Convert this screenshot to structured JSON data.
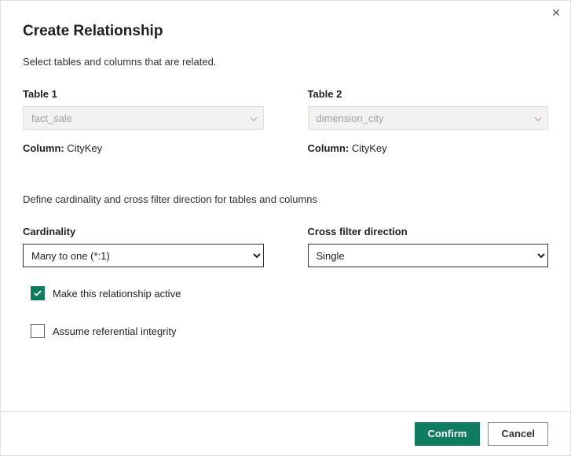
{
  "dialog": {
    "title": "Create Relationship",
    "subtitle": "Select tables and columns that are related."
  },
  "table1": {
    "label": "Table 1",
    "value": "fact_sale",
    "column_label": "Column:",
    "column_value": "CityKey"
  },
  "table2": {
    "label": "Table 2",
    "value": "dimension_city",
    "column_label": "Column:",
    "column_value": "CityKey"
  },
  "section2": {
    "text": "Define cardinality and cross filter direction for tables and columns"
  },
  "cardinality": {
    "label": "Cardinality",
    "value": "Many to one (*:1)"
  },
  "cross_filter": {
    "label": "Cross filter direction",
    "value": "Single"
  },
  "checkboxes": {
    "active_label": "Make this relationship active",
    "referential_label": "Assume referential integrity"
  },
  "footer": {
    "confirm": "Confirm",
    "cancel": "Cancel"
  }
}
